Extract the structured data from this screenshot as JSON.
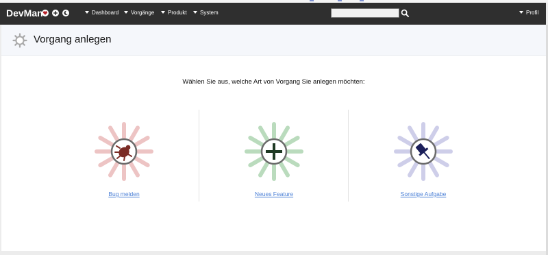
{
  "app": {
    "brand": "DevMan"
  },
  "nav": {
    "menus": [
      {
        "label": "Dashboard"
      },
      {
        "label": "Vorgänge"
      },
      {
        "label": "Produkt"
      },
      {
        "label": "System"
      }
    ],
    "profile_label": "Profil",
    "search": {
      "value": "",
      "placeholder": ""
    },
    "icons": [
      "heart-icon",
      "add-icon",
      "moon-icon",
      "search-icon"
    ]
  },
  "page": {
    "title": "Vorgang anlegen",
    "title_icon": "gear-icon",
    "prompt": "Wählen Sie aus, welche Art von Vorgang Sie anlegen möchten:"
  },
  "options": [
    {
      "label": "Bug melden",
      "icon": "bug-icon",
      "color": "#7a2b25"
    },
    {
      "label": "Neues Feature",
      "icon": "plus-icon",
      "color": "#1f3a24"
    },
    {
      "label": "Sonstige Aufgabe",
      "icon": "pushpin-icon",
      "color": "#1b1f5a"
    }
  ],
  "colors": {
    "navbar": "#2f2f2f",
    "link": "#4a7fd6",
    "bug_glow": "#e8b1b1",
    "feature_glow": "#a9d3ad",
    "task_glow": "#c6c6e6"
  }
}
